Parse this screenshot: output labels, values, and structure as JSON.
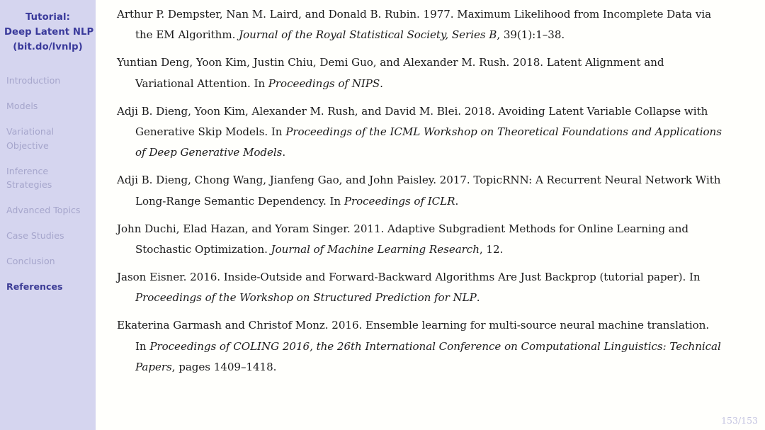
{
  "sidebar": {
    "title_lines": [
      "Tutorial:",
      "Deep Latent NLP",
      "(bit.do/lvnlp)"
    ],
    "items": [
      {
        "label": "Introduction",
        "active": false
      },
      {
        "label": "Models",
        "active": false
      },
      {
        "label": "Variational Objective",
        "active": false
      },
      {
        "label": "Inference Strategies",
        "active": false
      },
      {
        "label": "Advanced Topics",
        "active": false
      },
      {
        "label": "Case Studies",
        "active": false
      },
      {
        "label": "Conclusion",
        "active": false
      },
      {
        "label": "References",
        "active": true
      }
    ],
    "colors": {
      "background": "#d5d5ef",
      "title": "#39399b",
      "item_inactive": "#a6a6cc",
      "item_active": "#3d3d96"
    }
  },
  "main": {
    "references": [
      {
        "parts": [
          {
            "text": "Arthur P. Dempster, Nan M. Laird, and Donald B. Rubin. 1977. Maximum Likelihood from Incomplete Data via the EM Algorithm. ",
            "italic": false
          },
          {
            "text": "Journal of the Royal Statistical Society, Series B",
            "italic": true
          },
          {
            "text": ", 39(1):1–38.",
            "italic": false
          }
        ]
      },
      {
        "parts": [
          {
            "text": "Yuntian Deng, Yoon Kim, Justin Chiu, Demi Guo, and Alexander M. Rush. 2018. Latent Alignment and Variational Attention. In ",
            "italic": false
          },
          {
            "text": "Proceedings of NIPS",
            "italic": true
          },
          {
            "text": ".",
            "italic": false
          }
        ]
      },
      {
        "parts": [
          {
            "text": "Adji B. Dieng, Yoon Kim, Alexander M. Rush, and David M. Blei. 2018. Avoiding Latent Variable Collapse with Generative Skip Models. In ",
            "italic": false
          },
          {
            "text": "Proceedings of the ICML Workshop on Theoretical Foundations and Applications of Deep Generative Models",
            "italic": true
          },
          {
            "text": ".",
            "italic": false
          }
        ]
      },
      {
        "parts": [
          {
            "text": "Adji B. Dieng, Chong Wang, Jianfeng Gao, and John Paisley. 2017. TopicRNN: A Recurrent Neural Network With Long-Range Semantic Dependency. In ",
            "italic": false
          },
          {
            "text": "Proceedings of ICLR",
            "italic": true
          },
          {
            "text": ".",
            "italic": false
          }
        ]
      },
      {
        "parts": [
          {
            "text": "John Duchi, Elad Hazan, and Yoram Singer. 2011. Adaptive Subgradient Methods for Online Learning and Stochastic Optimization. ",
            "italic": false
          },
          {
            "text": "Journal of Machine Learning Research",
            "italic": true
          },
          {
            "text": ", 12.",
            "italic": false
          }
        ]
      },
      {
        "parts": [
          {
            "text": "Jason Eisner. 2016. Inside-Outside and Forward-Backward Algorithms Are Just Backprop (tutorial paper). In ",
            "italic": false
          },
          {
            "text": "Proceedings of the Workshop on Structured Prediction for NLP",
            "italic": true
          },
          {
            "text": ".",
            "italic": false
          }
        ]
      },
      {
        "parts": [
          {
            "text": "Ekaterina Garmash and Christof Monz. 2016. Ensemble learning for multi-source neural machine translation. In ",
            "italic": false
          },
          {
            "text": "Proceedings of COLING 2016, the 26th International Conference on Computational Linguistics: Technical Papers",
            "italic": true
          },
          {
            "text": ", pages 1409–1418.",
            "italic": false
          }
        ]
      }
    ],
    "page_number": "153/153"
  }
}
